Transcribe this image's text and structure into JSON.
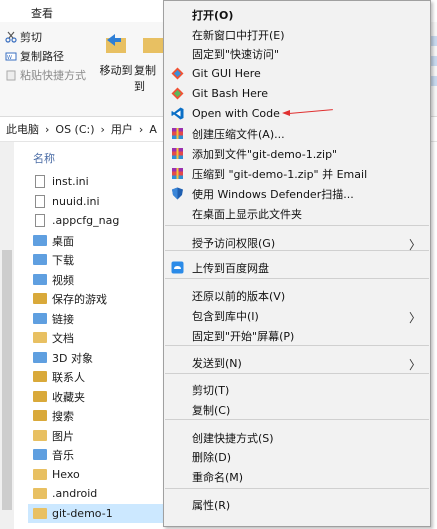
{
  "ribbon": {
    "tab_view": "查看",
    "cut": "剪切",
    "copy_path": "复制路径",
    "paste_shortcut": "粘贴快捷方式",
    "move_to": "移动到",
    "copy_to": "复制到"
  },
  "address": {
    "parts": [
      "此电脑",
      "OS (C:)",
      "用户",
      "A"
    ],
    "separator": "›"
  },
  "file_list": {
    "column_name": "名称",
    "items": [
      {
        "name": "inst.ini",
        "icon": "document-icon"
      },
      {
        "name": "nuuid.ini",
        "icon": "document-icon"
      },
      {
        "name": ".appcfg_nag",
        "icon": "document-icon"
      },
      {
        "name": "桌面",
        "icon": "desktop-folder-icon"
      },
      {
        "name": "下载",
        "icon": "downloads-folder-icon"
      },
      {
        "name": "视频",
        "icon": "videos-folder-icon"
      },
      {
        "name": "保存的游戏",
        "icon": "saved-games-folder-icon"
      },
      {
        "name": "链接",
        "icon": "links-folder-icon"
      },
      {
        "name": "文档",
        "icon": "documents-folder-icon"
      },
      {
        "name": "3D 对象",
        "icon": "3d-objects-folder-icon"
      },
      {
        "name": "联系人",
        "icon": "contacts-folder-icon"
      },
      {
        "name": "收藏夹",
        "icon": "favorites-folder-icon"
      },
      {
        "name": "搜索",
        "icon": "searches-folder-icon"
      },
      {
        "name": "图片",
        "icon": "pictures-folder-icon"
      },
      {
        "name": "音乐",
        "icon": "music-folder-icon"
      },
      {
        "name": "Hexo",
        "icon": "folder-icon"
      },
      {
        "name": ".android",
        "icon": "folder-icon"
      },
      {
        "name": "git-demo-1",
        "icon": "folder-icon",
        "selected": true
      }
    ]
  },
  "context_menu": {
    "items": [
      {
        "label": "打开(O)",
        "bold": true
      },
      {
        "label": "在新窗口中打开(E)"
      },
      {
        "label": "固定到\"快速访问\""
      },
      {
        "label": "Git GUI Here",
        "icon": "git-gui-icon"
      },
      {
        "label": "Git Bash Here",
        "icon": "git-bash-icon"
      },
      {
        "label": "Open with Code",
        "icon": "vscode-icon"
      },
      {
        "label": "创建压缩文件(A)...",
        "icon": "archive-icon"
      },
      {
        "label": "添加到文件\"git-demo-1.zip\"",
        "icon": "archive-icon"
      },
      {
        "label": "压缩到 \"git-demo-1.zip\" 并 Email",
        "icon": "archive-icon"
      },
      {
        "label": "使用 Windows Defender扫描...",
        "icon": "defender-icon"
      },
      {
        "label": "在桌面上显示此文件夹"
      },
      {
        "label": "授予访问权限(G)",
        "submenu": true
      },
      {
        "label": "上传到百度网盘",
        "icon": "baidu-netdisk-icon"
      },
      {
        "label": "还原以前的版本(V)"
      },
      {
        "label": "包含到库中(I)",
        "submenu": true
      },
      {
        "label": "固定到\"开始\"屏幕(P)"
      },
      {
        "label": "发送到(N)",
        "submenu": true
      },
      {
        "label": "剪切(T)"
      },
      {
        "label": "复制(C)"
      },
      {
        "label": "创建快捷方式(S)"
      },
      {
        "label": "删除(D)"
      },
      {
        "label": "重命名(M)"
      },
      {
        "label": "属性(R)"
      }
    ]
  },
  "colors": {
    "selection": "#cce8ff",
    "annotation_arrow": "#e03030",
    "menu_bg": "#f2f2f2"
  }
}
